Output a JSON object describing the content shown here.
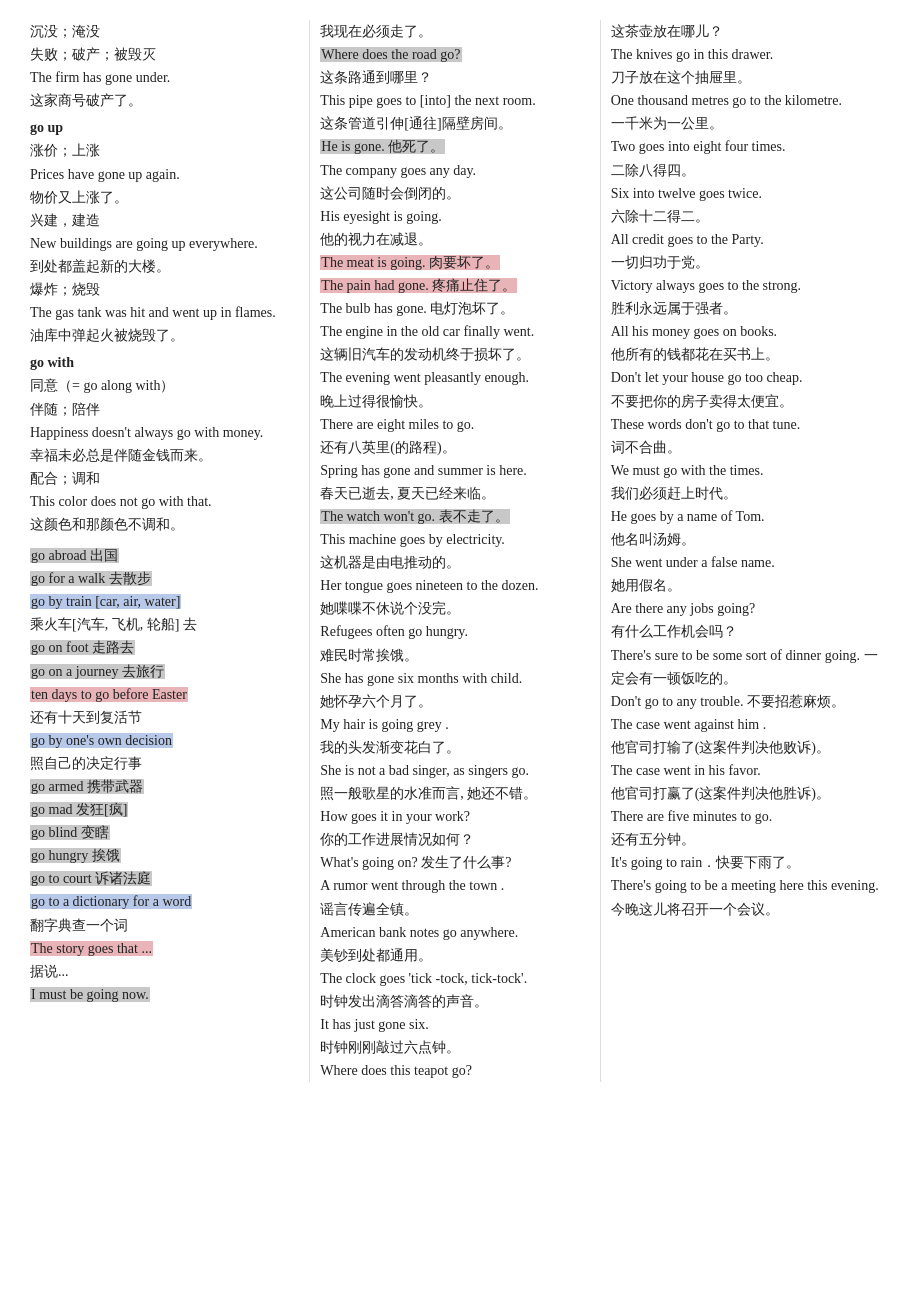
{
  "col1": {
    "lines": [
      {
        "type": "text",
        "text": "沉没；淹没"
      },
      {
        "type": "text",
        "text": "失败；破产；被毁灭"
      },
      {
        "type": "text",
        "text": "The firm has gone under."
      },
      {
        "type": "text",
        "text": "这家商号破产了。"
      },
      {
        "type": "bold",
        "text": "go up"
      },
      {
        "type": "text",
        "text": "涨价；上涨"
      },
      {
        "type": "text",
        "text": "Prices have gone up  again."
      },
      {
        "type": "text",
        "text": "物价又上涨了。"
      },
      {
        "type": "text",
        "text": "兴建，建造"
      },
      {
        "type": "text",
        "text": "New buildings  are going up everywhere."
      },
      {
        "type": "text",
        "text": "到处都盖起新的大楼。"
      },
      {
        "type": "text",
        "text": "爆炸；烧毁"
      },
      {
        "type": "text",
        "text": "The gas tank was hit and went up in flames."
      },
      {
        "type": "text",
        "text": "油库中弹起火被烧毁了。"
      },
      {
        "type": "bold",
        "text": "go with"
      },
      {
        "type": "text",
        "text": "同意（= go along  with）"
      },
      {
        "type": "text",
        "text": "伴随；陪伴"
      },
      {
        "type": "text",
        "text": "Happiness doesn't always go with money."
      },
      {
        "type": "text",
        "text": "幸福未必总是伴随金钱而来。"
      },
      {
        "type": "text",
        "text": "配合；调和"
      },
      {
        "type": "text",
        "text": "This color does not go with that."
      },
      {
        "type": "text",
        "text": "这颜色和那颜色不调和。"
      },
      {
        "type": "divider"
      },
      {
        "type": "highlight-gray",
        "text": "go abroad  出国"
      },
      {
        "type": "highlight-gray",
        "text": "go for a walk  去散步"
      },
      {
        "type": "highlight-blue",
        "text": "go by train [car, air, water]"
      },
      {
        "type": "text",
        "text": "乘火车[汽车, 飞机, 轮船] 去"
      },
      {
        "type": "highlight-gray",
        "text": "go on foot  走路去"
      },
      {
        "type": "highlight-gray",
        "text": "go on a journey  去旅行"
      },
      {
        "type": "highlight-pink",
        "text": "ten days to go before Easter"
      },
      {
        "type": "text",
        "text": "还有十天到复活节"
      },
      {
        "type": "highlight-blue",
        "text": "go by one's own decision"
      },
      {
        "type": "text",
        "text": "照自己的决定行事"
      },
      {
        "type": "highlight-gray",
        "text": "go armed  携带武器"
      },
      {
        "type": "highlight-gray",
        "text": "go mad  发狂[疯]"
      },
      {
        "type": "highlight-gray",
        "text": "go blind  变瞎"
      },
      {
        "type": "highlight-gray",
        "text": "go hungry  挨饿"
      },
      {
        "type": "highlight-gray",
        "text": "go to court  诉诸法庭"
      },
      {
        "type": "highlight-blue",
        "text": "go to a dictionary for a word"
      },
      {
        "type": "text",
        "text": "翻字典查一个词"
      },
      {
        "type": "highlight-pink",
        "text": "The story goes that ..."
      },
      {
        "type": "text",
        "text": "据说..."
      },
      {
        "type": "highlight-gray",
        "text": "I must be going now."
      }
    ]
  },
  "col2": {
    "lines": [
      {
        "type": "text",
        "text": "我现在必须走了。"
      },
      {
        "type": "highlight-gray",
        "text": "Where does the road go?"
      },
      {
        "type": "text",
        "text": "这条路通到哪里？"
      },
      {
        "type": "text",
        "text": "This pipe goes to [into] the next room."
      },
      {
        "type": "text",
        "text": "这条管道引伸[通往]隔壁房间。"
      },
      {
        "type": "highlight-gray",
        "text": "He is gone.  他死了。"
      },
      {
        "type": "text",
        "text": "The company goes any day."
      },
      {
        "type": "text",
        "text": "这公司随时会倒闭的。"
      },
      {
        "type": "text",
        "text": "His eyesight is going."
      },
      {
        "type": "text",
        "text": "他的视力在减退。"
      },
      {
        "type": "highlight-pink",
        "text": "The meat is going.  肉要坏了。"
      },
      {
        "type": "highlight-pink",
        "text": "The pain had gone.  疼痛止住了。"
      },
      {
        "type": "text",
        "text": "The bulb has gone.  电灯泡坏了。"
      },
      {
        "type": "text",
        "text": "The engine in the old car finally went."
      },
      {
        "type": "text",
        "text": "这辆旧汽车的发动机终于损坏了。"
      },
      {
        "type": "text",
        "text": "The evening went pleasantly enough."
      },
      {
        "type": "text",
        "text": "晚上过得很愉快。"
      },
      {
        "type": "text",
        "text": "There are eight miles to go."
      },
      {
        "type": "text",
        "text": "还有八英里(的路程)。"
      },
      {
        "type": "text",
        "text": "Spring has gone and summer is here."
      },
      {
        "type": "text",
        "text": "春天已逝去, 夏天已经来临。"
      },
      {
        "type": "highlight-gray",
        "text": "The watch won't go.  表不走了。"
      },
      {
        "type": "text",
        "text": "This machine goes by electricity."
      },
      {
        "type": "text",
        "text": "这机器是由电推动的。"
      },
      {
        "type": "text",
        "text": "Her tongue goes nineteen to the dozen."
      },
      {
        "type": "text",
        "text": "她喋喋不休说个没完。"
      },
      {
        "type": "text",
        "text": "Refugees often go hungry."
      },
      {
        "type": "text",
        "text": "难民时常挨饿。"
      },
      {
        "type": "text",
        "text": "She has gone six months with child."
      },
      {
        "type": "text",
        "text": "她怀孕六个月了。"
      },
      {
        "type": "text",
        "text": "My hair is going grey ."
      },
      {
        "type": "text",
        "text": "我的头发渐变花白了。"
      },
      {
        "type": "text",
        "text": "She is not a bad singer, as singers go."
      },
      {
        "type": "text",
        "text": "照一般歌星的水准而言, 她还不错。"
      },
      {
        "type": "text",
        "text": "How goes it in your work?"
      },
      {
        "type": "text",
        "text": "你的工作进展情况如何？"
      },
      {
        "type": "text",
        "text": "What's going on?  发生了什么事?"
      },
      {
        "type": "text",
        "text": "A rumor went through the town ."
      },
      {
        "type": "text",
        "text": "谣言传遍全镇。"
      },
      {
        "type": "text",
        "text": "American bank notes go anywhere."
      },
      {
        "type": "text",
        "text": "美钞到处都通用。"
      },
      {
        "type": "text",
        "text": "The clock goes 'tick -tock, tick-tock'."
      },
      {
        "type": "text",
        "text": "时钟发出滴答滴答的声音。"
      },
      {
        "type": "text",
        "text": "It has just gone six."
      },
      {
        "type": "text",
        "text": "时钟刚刚敲过六点钟。"
      },
      {
        "type": "text",
        "text": "Where does this teapot go?"
      }
    ]
  },
  "col3": {
    "lines": [
      {
        "type": "text",
        "text": "这茶壶放在哪儿？"
      },
      {
        "type": "text",
        "text": "The knives go in this drawer."
      },
      {
        "type": "text",
        "text": "刀子放在这个抽屉里。"
      },
      {
        "type": "text",
        "text": "One thousand metres go to the kilometre."
      },
      {
        "type": "text",
        "text": "一千米为一公里。"
      },
      {
        "type": "text",
        "text": "Two goes into eight four times."
      },
      {
        "type": "text",
        "text": "二除八得四。"
      },
      {
        "type": "text",
        "text": "Six into twelve goes twice."
      },
      {
        "type": "text",
        "text": "六除十二得二。"
      },
      {
        "type": "text",
        "text": "All credit goes to the Party."
      },
      {
        "type": "text",
        "text": "一切归功于党。"
      },
      {
        "type": "text",
        "text": "Victory always goes to the strong."
      },
      {
        "type": "text",
        "text": "胜利永远属于强者。"
      },
      {
        "type": "text",
        "text": "All his money goes on books."
      },
      {
        "type": "text",
        "text": "他所有的钱都花在买书上。"
      },
      {
        "type": "text",
        "text": "Don't let your house go too cheap."
      },
      {
        "type": "text",
        "text": "不要把你的房子卖得太便宜。"
      },
      {
        "type": "text",
        "text": "These words don't go to that tune."
      },
      {
        "type": "text",
        "text": "词不合曲。"
      },
      {
        "type": "text",
        "text": "We must go with the times."
      },
      {
        "type": "text",
        "text": "我们必须赶上时代。"
      },
      {
        "type": "text",
        "text": "He goes by a name of Tom."
      },
      {
        "type": "text",
        "text": "他名叫汤姆。"
      },
      {
        "type": "text",
        "text": "She went under a false name."
      },
      {
        "type": "text",
        "text": "她用假名。"
      },
      {
        "type": "text",
        "text": "Are there any jobs going?"
      },
      {
        "type": "text",
        "text": "有什么工作机会吗？"
      },
      {
        "type": "text",
        "text": "There's sure to be some sort of dinner going.  一定会有一顿饭吃的。"
      },
      {
        "type": "text",
        "text": "Don't go to any trouble.  不要招惹麻烦。"
      },
      {
        "type": "text",
        "text": "The case went against him ."
      },
      {
        "type": "text",
        "text": "他官司打输了(这案件判决他败诉)。"
      },
      {
        "type": "text",
        "text": "The case went in his favor."
      },
      {
        "type": "text",
        "text": "他官司打赢了(这案件判决他胜诉)。"
      },
      {
        "type": "text",
        "text": "There are five minutes to go."
      },
      {
        "type": "text",
        "text": "还有五分钟。"
      },
      {
        "type": "text",
        "text": "It's going to rain．快要下雨了。"
      },
      {
        "type": "text",
        "text": "There's going to be a meeting here this evening.  今晚这儿将召开一个会议。"
      }
    ]
  }
}
